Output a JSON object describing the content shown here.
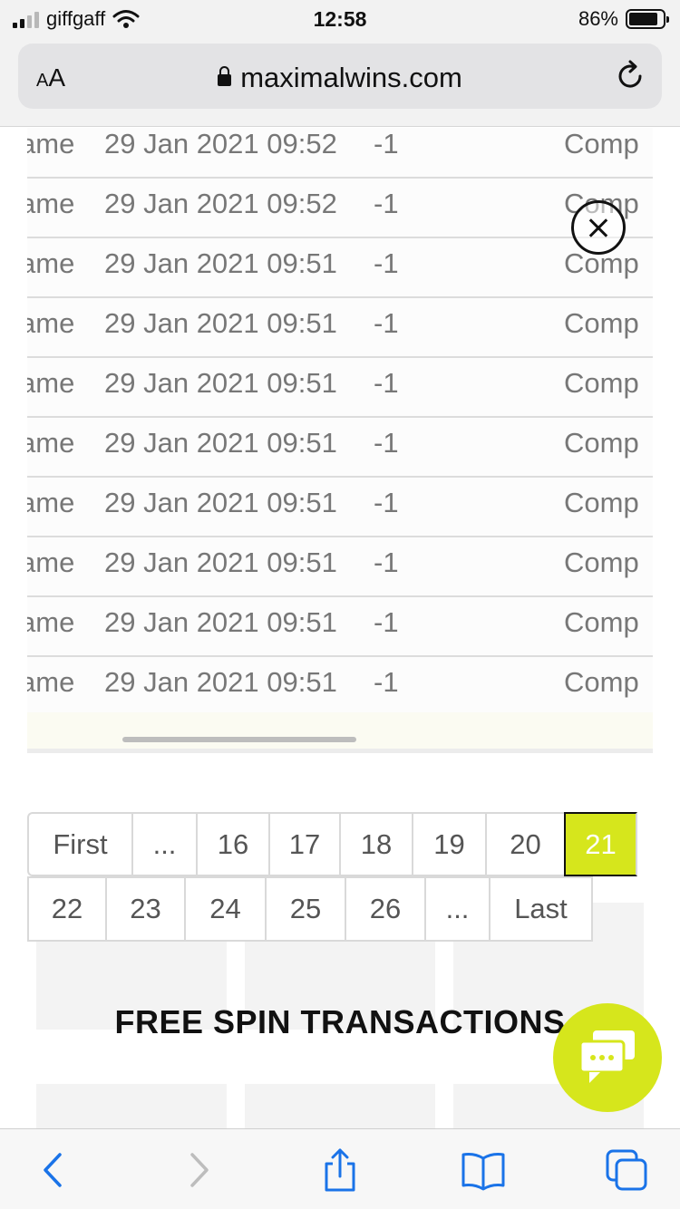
{
  "status_bar": {
    "carrier": "giffgaff",
    "time": "12:58",
    "battery_percent": "86%",
    "battery_level": 0.86
  },
  "browser": {
    "text_size_button": "AA",
    "url": "maximalwins.com"
  },
  "transactions": {
    "rows": [
      {
        "game": "ame",
        "date": "29 Jan 2021 09:52",
        "amount": "-1",
        "status": "Comp"
      },
      {
        "game": "ame",
        "date": "29 Jan 2021 09:52",
        "amount": "-1",
        "status": "Comp"
      },
      {
        "game": "ame",
        "date": "29 Jan 2021 09:51",
        "amount": "-1",
        "status": "Comp"
      },
      {
        "game": "ame",
        "date": "29 Jan 2021 09:51",
        "amount": "-1",
        "status": "Comp"
      },
      {
        "game": "ame",
        "date": "29 Jan 2021 09:51",
        "amount": "-1",
        "status": "Comp"
      },
      {
        "game": "ame",
        "date": "29 Jan 2021 09:51",
        "amount": "-1",
        "status": "Comp"
      },
      {
        "game": "ame",
        "date": "29 Jan 2021 09:51",
        "amount": "-1",
        "status": "Comp"
      },
      {
        "game": "ame",
        "date": "29 Jan 2021 09:51",
        "amount": "-1",
        "status": "Comp"
      },
      {
        "game": "ame",
        "date": "29 Jan 2021 09:51",
        "amount": "-1",
        "status": "Comp"
      },
      {
        "game": "ame",
        "date": "29 Jan 2021 09:51",
        "amount": "-1",
        "status": "Comp"
      }
    ]
  },
  "pagination": {
    "row1": [
      {
        "label": "First",
        "w": 115
      },
      {
        "label": "...",
        "w": 71
      },
      {
        "label": "16",
        "w": 80
      },
      {
        "label": "17",
        "w": 78
      },
      {
        "label": "18",
        "w": 80
      },
      {
        "label": "19",
        "w": 81
      },
      {
        "label": "20",
        "w": 87
      },
      {
        "label": "21",
        "w": 81,
        "active": true
      }
    ],
    "row2": [
      {
        "label": "22",
        "w": 86
      },
      {
        "label": "23",
        "w": 87
      },
      {
        "label": "24",
        "w": 89
      },
      {
        "label": "25",
        "w": 88
      },
      {
        "label": "26",
        "w": 88
      },
      {
        "label": "...",
        "w": 71
      },
      {
        "label": "Last",
        "w": 115
      }
    ],
    "current_page": "21"
  },
  "section_title": "FREE SPIN TRANSACTIONS",
  "colors": {
    "accent": "#d6e61c",
    "link_blue": "#1a73e8"
  },
  "toolbar": {
    "icons": [
      "back-icon",
      "forward-icon",
      "share-icon",
      "bookmarks-icon",
      "tabs-icon"
    ]
  }
}
